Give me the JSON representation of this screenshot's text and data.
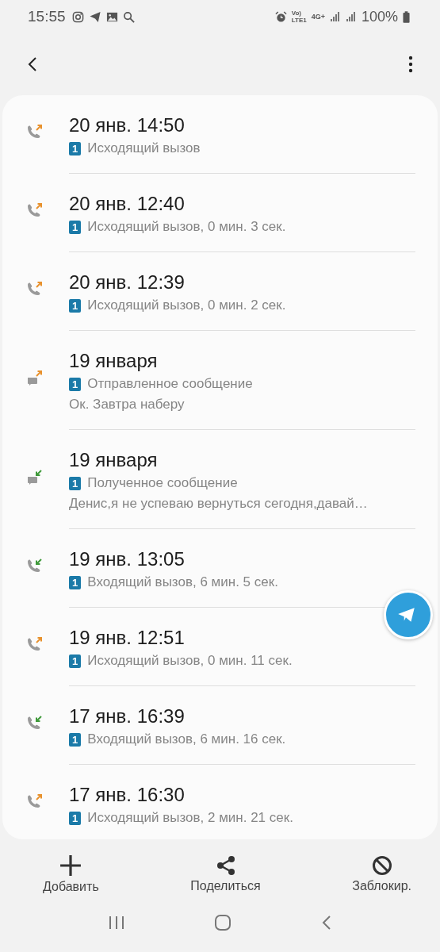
{
  "status_bar": {
    "time": "15:55",
    "volte": "Vo)",
    "lte": "LTE1",
    "network": "4G+",
    "battery": "100%"
  },
  "entries": [
    {
      "kind": "call",
      "outgoing": true,
      "date": "20 янв. 14:50",
      "sim": "1",
      "detail": "Исходящий вызов"
    },
    {
      "kind": "call",
      "outgoing": true,
      "date": "20 янв. 12:40",
      "sim": "1",
      "detail": "Исходящий вызов, 0 мин. 3 сек."
    },
    {
      "kind": "call",
      "outgoing": true,
      "date": "20 янв. 12:39",
      "sim": "1",
      "detail": "Исходящий вызов, 0 мин. 2 сек."
    },
    {
      "kind": "message",
      "outgoing": true,
      "date": "19 января",
      "sim": "1",
      "detail": "Отправленное сообщение",
      "preview": "Ок. Завтра наберу"
    },
    {
      "kind": "message",
      "outgoing": false,
      "date": "19 января",
      "sim": "1",
      "detail": "Полученное сообщение",
      "preview": "Денис,я не успеваю вернуться сегодня,давай…"
    },
    {
      "kind": "call",
      "outgoing": false,
      "date": "19 янв. 13:05",
      "sim": "1",
      "detail": "Входящий вызов, 6 мин. 5 сек."
    },
    {
      "kind": "call",
      "outgoing": true,
      "date": "19 янв. 12:51",
      "sim": "1",
      "detail": "Исходящий вызов, 0 мин. 11 сек."
    },
    {
      "kind": "call",
      "outgoing": false,
      "date": "17 янв. 16:39",
      "sim": "1",
      "detail": "Входящий вызов, 6 мин. 16 сек."
    },
    {
      "kind": "call",
      "outgoing": true,
      "date": "17 янв. 16:30",
      "sim": "1",
      "detail": "Исходящий вызов, 2 мин. 21 сек."
    }
  ],
  "actions": [
    {
      "kind": "add",
      "label": "Добавить"
    },
    {
      "kind": "share",
      "label": "Поделиться"
    },
    {
      "kind": "block",
      "label": "Заблокир."
    }
  ]
}
